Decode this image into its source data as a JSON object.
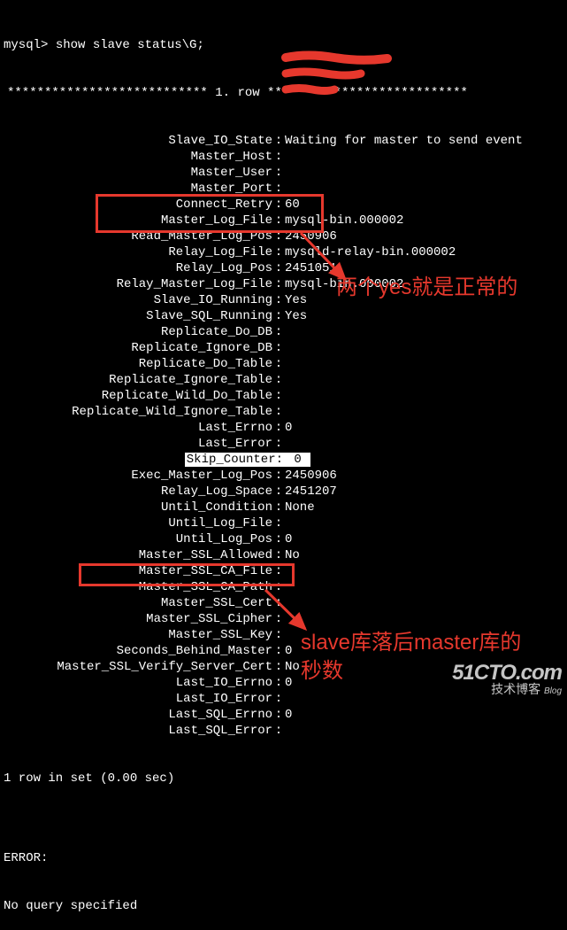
{
  "prompt": "mysql> ",
  "command": "show slave status\\G;",
  "row_separator": "*************************** 1. row ***************************",
  "fields": [
    {
      "label": "Slave_IO_State",
      "value": "Waiting for master to send event"
    },
    {
      "label": "Master_Host",
      "value": " "
    },
    {
      "label": "Master_User",
      "value": " "
    },
    {
      "label": "Master_Port",
      "value": " "
    },
    {
      "label": "Connect_Retry",
      "value": "60"
    },
    {
      "label": "Master_Log_File",
      "value": "mysql-bin.000002"
    },
    {
      "label": "Read_Master_Log_Pos",
      "value": "2450906"
    },
    {
      "label": "Relay_Log_File",
      "value": "mysqld-relay-bin.000002"
    },
    {
      "label": "Relay_Log_Pos",
      "value": "2451051"
    },
    {
      "label": "Relay_Master_Log_File",
      "value": "mysql-bin.000002"
    },
    {
      "label": "Slave_IO_Running",
      "value": "Yes"
    },
    {
      "label": "Slave_SQL_Running",
      "value": "Yes"
    },
    {
      "label": "Replicate_Do_DB",
      "value": ""
    },
    {
      "label": "Replicate_Ignore_DB",
      "value": ""
    },
    {
      "label": "Replicate_Do_Table",
      "value": ""
    },
    {
      "label": "Replicate_Ignore_Table",
      "value": ""
    },
    {
      "label": "Replicate_Wild_Do_Table",
      "value": ""
    },
    {
      "label": "Replicate_Wild_Ignore_Table",
      "value": ""
    },
    {
      "label": "Last_Errno",
      "value": "0"
    },
    {
      "label": "Last_Error",
      "value": ""
    },
    {
      "label": "Skip_Counter",
      "value": "0",
      "highlight": true
    },
    {
      "label": "Exec_Master_Log_Pos",
      "value": "2450906"
    },
    {
      "label": "Relay_Log_Space",
      "value": "2451207"
    },
    {
      "label": "Until_Condition",
      "value": "None"
    },
    {
      "label": "Until_Log_File",
      "value": ""
    },
    {
      "label": "Until_Log_Pos",
      "value": "0"
    },
    {
      "label": "Master_SSL_Allowed",
      "value": "No"
    },
    {
      "label": "Master_SSL_CA_File",
      "value": ""
    },
    {
      "label": "Master_SSL_CA_Path",
      "value": ""
    },
    {
      "label": "Master_SSL_Cert",
      "value": ""
    },
    {
      "label": "Master_SSL_Cipher",
      "value": ""
    },
    {
      "label": "Master_SSL_Key",
      "value": ""
    },
    {
      "label": "Seconds_Behind_Master",
      "value": "0"
    },
    {
      "label": "Master_SSL_Verify_Server_Cert",
      "value": "No"
    },
    {
      "label": "Last_IO_Errno",
      "value": "0"
    },
    {
      "label": "Last_IO_Error",
      "value": ""
    },
    {
      "label": "Last_SQL_Errno",
      "value": "0"
    },
    {
      "label": "Last_SQL_Error",
      "value": ""
    }
  ],
  "footer_rows": "1 row in set (0.00 sec)",
  "footer_blank": "",
  "footer_error": "ERROR:",
  "footer_noquery": "No query specified",
  "annotations": {
    "yes_note": "两个yes就是正常的",
    "seconds_note_1": "slave库落后master库的",
    "seconds_note_2": "秒数"
  },
  "watermark": {
    "main": "51CTO.com",
    "sub": "技术博客",
    "blog": "Blog"
  },
  "colors": {
    "highlight": "#e6382d"
  }
}
